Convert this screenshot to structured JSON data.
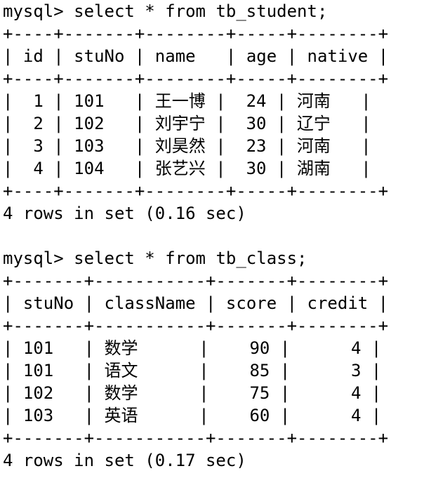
{
  "queries": [
    {
      "prompt": "mysql>",
      "command": "select * from tb_student;",
      "border": "+----+-------+--------+-----+--------+",
      "header": [
        "id",
        "stuNo",
        "name",
        "age",
        "native"
      ],
      "rows": [
        [
          "1",
          "101",
          "王一博",
          "24",
          "河南"
        ],
        [
          "2",
          "102",
          "刘宇宁",
          "30",
          "辽宁"
        ],
        [
          "3",
          "103",
          "刘昊然",
          "23",
          "河南"
        ],
        [
          "4",
          "104",
          "张艺兴",
          "30",
          "湖南"
        ]
      ],
      "result": "4 rows in set (0.16 sec)"
    },
    {
      "prompt": "mysql>",
      "command": "select * from tb_class;",
      "border": "+-------+-----------+-------+--------+",
      "header": [
        "stuNo",
        "className",
        "score",
        "credit"
      ],
      "rows": [
        [
          "101",
          "数学",
          "90",
          "4"
        ],
        [
          "101",
          "语文",
          "85",
          "3"
        ],
        [
          "102",
          "数学",
          "75",
          "4"
        ],
        [
          "103",
          "英语",
          "60",
          "4"
        ]
      ],
      "result": "4 rows in set (0.17 sec)"
    }
  ]
}
